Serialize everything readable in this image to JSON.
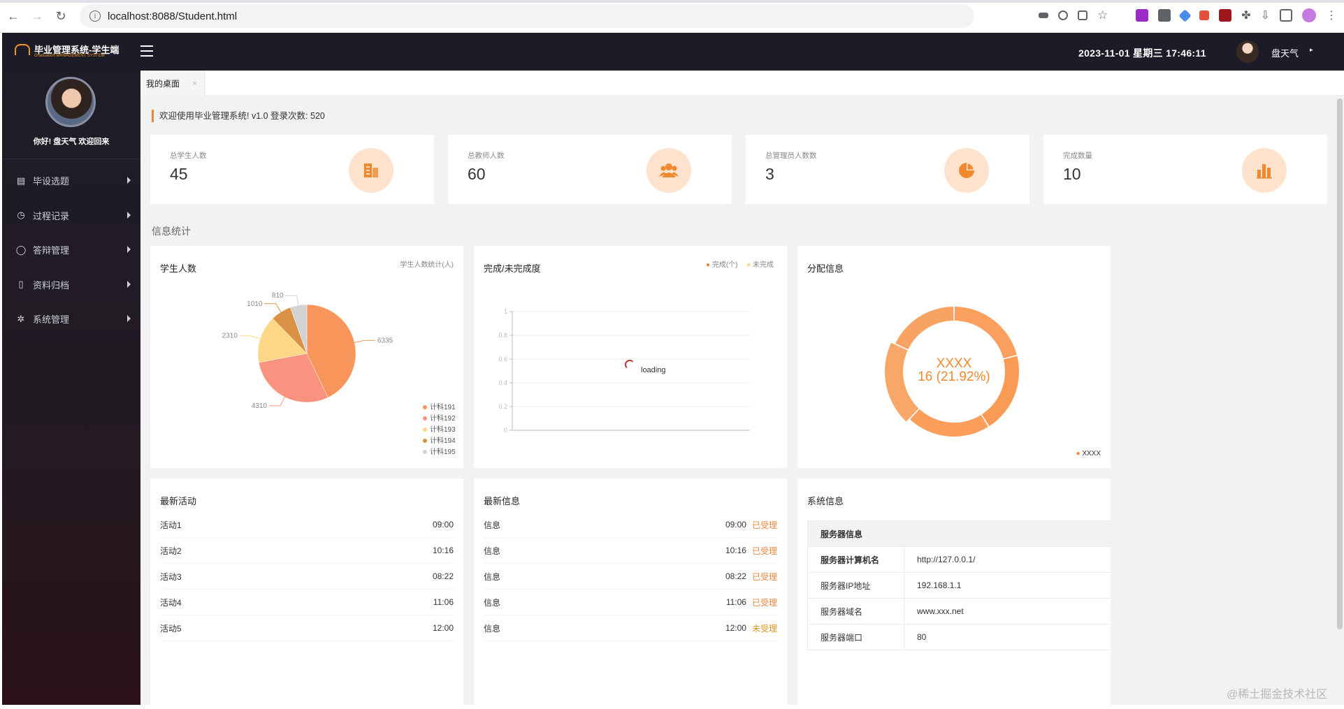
{
  "browser": {
    "url": "localhost:8088/Student.html",
    "back": "←",
    "forward": "→",
    "reload": "↻"
  },
  "header": {
    "logo_title": "毕业管理系统-学生端",
    "logo_subtitle": "Graduation MANAGEMENT SYSTEM",
    "datetime": "2023-11-01  星期三  17:46:11",
    "user_name": "盘天气"
  },
  "sidebar": {
    "greeting": "你好!  盘天气 欢迎回来",
    "items": [
      {
        "label": "毕设选题",
        "icon": "document-icon",
        "glyph": "▤"
      },
      {
        "label": "过程记录",
        "icon": "clock-icon",
        "glyph": "◷"
      },
      {
        "label": "答辩管理",
        "icon": "circle-icon",
        "glyph": "◯"
      },
      {
        "label": "资料归档",
        "icon": "file-icon",
        "glyph": "▯"
      },
      {
        "label": "系统管理",
        "icon": "gear-icon",
        "glyph": "✲"
      }
    ]
  },
  "tabs": [
    {
      "label": "我的桌面",
      "close": "×"
    }
  ],
  "welcome": "欢迎使用毕业管理系统! v1.0   登录次数: 520",
  "stats": [
    {
      "label": "总学生人数",
      "value": "45",
      "icon": "building-icon"
    },
    {
      "label": "总教师人数",
      "value": "60",
      "icon": "users-icon"
    },
    {
      "label": "总管理员人数数",
      "value": "3",
      "icon": "pie-icon"
    },
    {
      "label": "完成数量",
      "value": "10",
      "icon": "bar-chart-icon"
    }
  ],
  "section_title": "信息统计",
  "panels": {
    "students": {
      "title": "学生人数",
      "legend_label": "学生人数统计(人)"
    },
    "completion": {
      "title": "完成/未完成度",
      "legend": [
        "完成(个)",
        "未完成"
      ],
      "loading": "loading"
    },
    "allocation": {
      "title": "分配信息",
      "legend": "XXXX"
    },
    "activities": {
      "title": "最新活动"
    },
    "news": {
      "title": "最新信息"
    },
    "system": {
      "title": "系统信息"
    }
  },
  "chart_data": [
    {
      "type": "pie",
      "title": "学生人数",
      "legend_title": "学生人数统计(人)",
      "categories": [
        "计科191",
        "计科192",
        "计科193",
        "计科194",
        "计科195"
      ],
      "values": [
        6335,
        4310,
        2310,
        1010,
        810
      ],
      "colors": [
        "#f7955a",
        "#f99380",
        "#fdd786",
        "#d99245",
        "#d3d3d3"
      ],
      "legend_position": "bottom-right"
    },
    {
      "type": "line",
      "title": "完成/未完成度",
      "series": [
        {
          "name": "完成(个)",
          "values": []
        },
        {
          "name": "未完成",
          "values": []
        }
      ],
      "ylim": [
        0,
        1
      ],
      "yticks": [
        "0",
        "0.2",
        "0.4",
        "0.6",
        "0.8",
        "1"
      ],
      "colors": [
        "#e8863c",
        "#fbd68b"
      ]
    },
    {
      "type": "pie",
      "title": "分配信息",
      "categories": [
        "XXXX"
      ],
      "values": [
        16
      ],
      "center_label": "XXXX",
      "center_value": "16 (21.92%)",
      "color": "#f8a060",
      "legend_position": "bottom-right"
    }
  ],
  "activities": [
    {
      "name": "活动1",
      "time": "09:00"
    },
    {
      "name": "活动2",
      "time": "10:16"
    },
    {
      "name": "活动3",
      "time": "08:22"
    },
    {
      "name": "活动4",
      "time": "11:06"
    },
    {
      "name": "活动5",
      "time": "12:00"
    }
  ],
  "news": [
    {
      "name": "信息",
      "time": "09:00",
      "status": "已受理"
    },
    {
      "name": "信息",
      "time": "10:16",
      "status": "已受理"
    },
    {
      "name": "信息",
      "time": "08:22",
      "status": "已受理"
    },
    {
      "name": "信息",
      "time": "11:06",
      "status": "已受理"
    },
    {
      "name": "信息",
      "time": "12:00",
      "status": "未受理"
    }
  ],
  "system_info": {
    "header": "服务器信息",
    "rows": [
      {
        "key": "服务器计算机名",
        "value": "http://127.0.0.1/"
      },
      {
        "key": "服务器IP地址",
        "value": "192.168.1.1"
      },
      {
        "key": "服务器域名",
        "value": "www.xxx.net"
      },
      {
        "key": "服务器端口",
        "value": "80"
      }
    ]
  },
  "watermark": "@稀土掘金技术社区",
  "accent_color": "#e8863c"
}
